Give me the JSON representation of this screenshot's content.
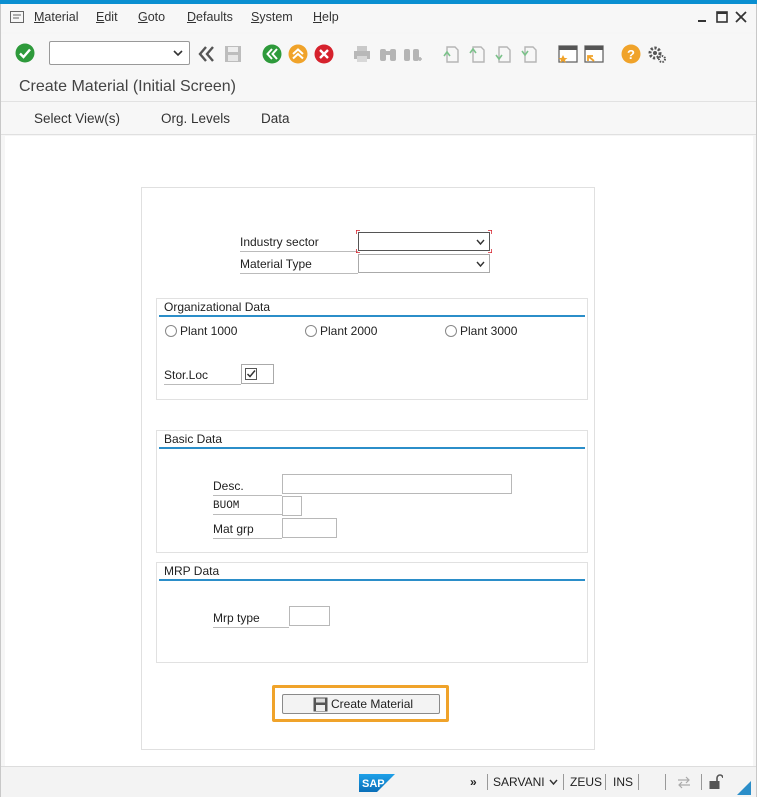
{
  "menu": {
    "items": [
      "Material",
      "Edit",
      "Goto",
      "Defaults",
      "System",
      "Help"
    ]
  },
  "toolbar": {
    "command_value": "",
    "icons": [
      "check-icon",
      "back-icon",
      "save-icon",
      "back-green-icon",
      "exit-icon",
      "cancel-icon",
      "print-icon",
      "find-icon",
      "find-next-icon",
      "first-page-icon",
      "prev-page-icon",
      "next-page-icon",
      "last-page-icon",
      "new-session-icon",
      "shortcut-icon",
      "help-icon",
      "settings-icon"
    ]
  },
  "title": "Create Material (Initial Screen)",
  "app_toolbar": [
    "Select View(s)",
    "Org. Levels",
    "Data"
  ],
  "form": {
    "industry_sector_label": "Industry sector",
    "industry_sector_value": "",
    "material_type_label": "Material Type",
    "material_type_value": "",
    "org_title": "Organizational Data",
    "plants": [
      "Plant 1000",
      "Plant 2000",
      "Plant 3000"
    ],
    "storloc_label": "Stor.Loc",
    "storloc_checked": true,
    "basic_title": "Basic Data",
    "desc_label": "Desc.",
    "buom_label": "BUOM",
    "matgrp_label": "Mat grp",
    "mrp_title": "MRP Data",
    "mrptype_label": "Mrp type",
    "create_button": "Create Material"
  },
  "status": {
    "user": "SARVANI",
    "server": "ZEUS",
    "mode": "INS",
    "logo": "SAP"
  },
  "colors": {
    "accent": "#0a8fd1",
    "highlight": "#f0a32a",
    "group_line": "#2b8ec9"
  }
}
